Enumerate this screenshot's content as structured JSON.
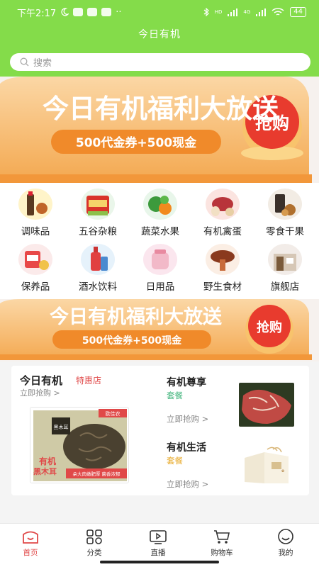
{
  "status_bar": {
    "time": "下午2:17",
    "battery": "44",
    "signal_1": "HD",
    "signal_2": "4G",
    "more": "··"
  },
  "header": {
    "title": "今日有机"
  },
  "search": {
    "placeholder": "搜索"
  },
  "banner": {
    "headline": "今日有机福利大放送",
    "coupon": "500代金券+500现金",
    "button": "抢购"
  },
  "categories": [
    {
      "label": "调味品",
      "icon": "condiment-icon"
    },
    {
      "label": "五谷杂粮",
      "icon": "grain-icon"
    },
    {
      "label": "蔬菜水果",
      "icon": "vegetable-icon"
    },
    {
      "label": "有机禽蛋",
      "icon": "meat-egg-icon"
    },
    {
      "label": "零食干果",
      "icon": "snack-icon"
    },
    {
      "label": "保养品",
      "icon": "supplement-icon"
    },
    {
      "label": "酒水饮料",
      "icon": "drink-icon"
    },
    {
      "label": "日用品",
      "icon": "daily-goods-icon"
    },
    {
      "label": "野生食材",
      "icon": "wild-food-icon"
    },
    {
      "label": "旗舰店",
      "icon": "flagship-store-icon"
    }
  ],
  "promo": {
    "title": "今日有机",
    "tag": "特惠店",
    "link": "立即抢购 >",
    "product_box_text": {
      "brand": "欧佳农",
      "name": "黑木耳",
      "big": "有机",
      "big2": "黑木耳",
      "slogan": "朵大肉嫩肥厚 菌香浓郁"
    },
    "items": [
      {
        "title": "有机尊享",
        "subtitle": "套餐",
        "link": "立即抢购 >"
      },
      {
        "title": "有机生活",
        "subtitle": "套餐",
        "link": "立即抢购 >"
      }
    ]
  },
  "nav": [
    {
      "label": "首页",
      "icon": "home-icon",
      "active": true
    },
    {
      "label": "分类",
      "icon": "category-icon",
      "active": false
    },
    {
      "label": "直播",
      "icon": "live-icon",
      "active": false
    },
    {
      "label": "购物车",
      "icon": "cart-icon",
      "active": false
    },
    {
      "label": "我的",
      "icon": "profile-icon",
      "active": false
    }
  ],
  "colors": {
    "header_green": "#84dc4a",
    "accent_red": "#e04848",
    "banner_orange": "#f5b560"
  }
}
